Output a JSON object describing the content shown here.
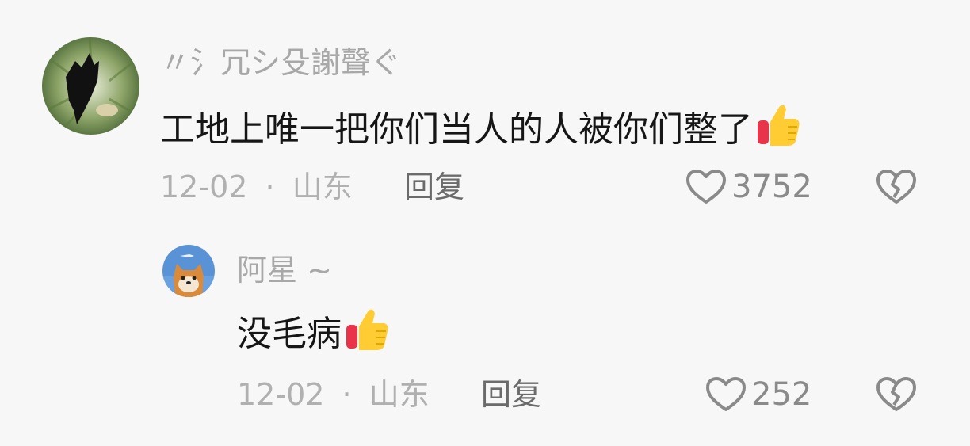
{
  "comments": [
    {
      "username": "〃氵冗シ殳謝聲ぐ",
      "text": "工地上唯一把你们当人的人被你们整了",
      "date": "12-02",
      "separator": "·",
      "location": "山东",
      "reply_label": "回复",
      "likes": "3752"
    },
    {
      "username": "阿星 ~",
      "text": "没毛病",
      "date": "12-02",
      "separator": "·",
      "location": "山东",
      "reply_label": "回复",
      "likes": "252"
    }
  ],
  "icons": {
    "like": "heart-outline-icon",
    "dislike": "broken-heart-icon",
    "emoji": "thumbs-up-emoji"
  },
  "colors": {
    "background": "#f7f7f7",
    "text": "#161616",
    "username": "#a8a8a8",
    "meta": "#b0b0b0",
    "reply": "#6b6b6b"
  }
}
